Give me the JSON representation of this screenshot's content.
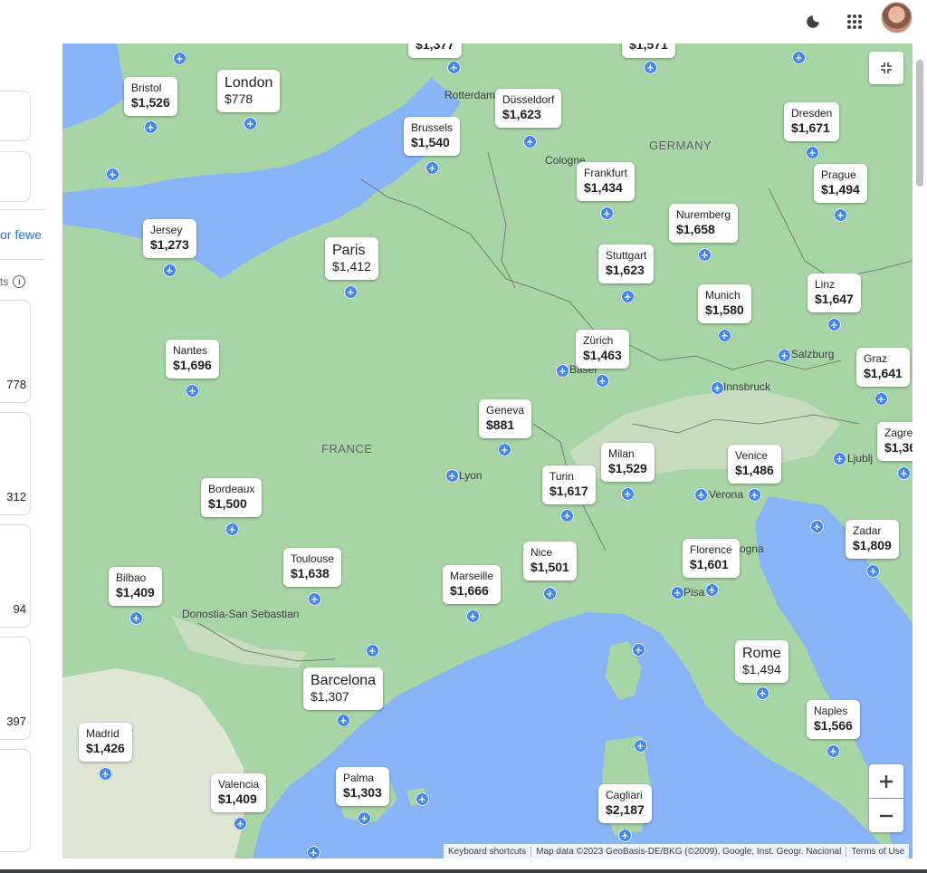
{
  "icons": {
    "theme": "moon-icon",
    "apps": "grid-icon",
    "airport": "plane-icon"
  },
  "left_panel": {
    "fewer_text": "or fewe",
    "pts_text": "ts",
    "card_prices": [
      "778",
      "312",
      "94",
      "397"
    ]
  },
  "map_labels": [
    {
      "name": "rotterdam",
      "text": "Rotterdam"
    },
    {
      "name": "cologne",
      "text": "Cologne"
    },
    {
      "name": "germany",
      "text": "GERMANY"
    },
    {
      "name": "france",
      "text": "FRANCE"
    },
    {
      "name": "basel",
      "text": "Basel"
    },
    {
      "name": "lyon",
      "text": "Lyon"
    },
    {
      "name": "salzburg",
      "text": "Salzburg"
    },
    {
      "name": "innsbruck",
      "text": "Innsbruck"
    },
    {
      "name": "verona",
      "text": "Verona"
    },
    {
      "name": "ljubljana",
      "text": "Ljublj"
    },
    {
      "name": "bologna",
      "text": "ogna"
    },
    {
      "name": "pisa",
      "text": "Pisa"
    },
    {
      "name": "donostia",
      "text": "Donostia-San Sebastian"
    }
  ],
  "destinations": [
    {
      "city": "",
      "price": "$1,377"
    },
    {
      "city": "",
      "price": "$1,571"
    },
    {
      "city": "Bristol",
      "price": "$1,526"
    },
    {
      "city": "London",
      "price": "$778"
    },
    {
      "city": "Düsseldorf",
      "price": "$1,623"
    },
    {
      "city": "Brussels",
      "price": "$1,540"
    },
    {
      "city": "Dresden",
      "price": "$1,671"
    },
    {
      "city": "Frankfurt",
      "price": "$1,434"
    },
    {
      "city": "Prague",
      "price": "$1,494"
    },
    {
      "city": "Jersey",
      "price": "$1,273"
    },
    {
      "city": "Nuremberg",
      "price": "$1,658"
    },
    {
      "city": "Paris",
      "price": "$1,412"
    },
    {
      "city": "Stuttgart",
      "price": "$1,623"
    },
    {
      "city": "Linz",
      "price": "$1,647"
    },
    {
      "city": "Munich",
      "price": "$1,580"
    },
    {
      "city": "Nantes",
      "price": "$1,696"
    },
    {
      "city": "Zürich",
      "price": "$1,463"
    },
    {
      "city": "Graz",
      "price": "$1,641"
    },
    {
      "city": "Geneva",
      "price": "$881"
    },
    {
      "city": "Zagre",
      "price": "$1,36"
    },
    {
      "city": "Milan",
      "price": "$1,529"
    },
    {
      "city": "Venice",
      "price": "$1,486"
    },
    {
      "city": "Turin",
      "price": "$1,617"
    },
    {
      "city": "Bordeaux",
      "price": "$1,500"
    },
    {
      "city": "Zadar",
      "price": "$1,809"
    },
    {
      "city": "Toulouse",
      "price": "$1,638"
    },
    {
      "city": "Nice",
      "price": "$1,501"
    },
    {
      "city": "Florence",
      "price": "$1,601"
    },
    {
      "city": "Bilbao",
      "price": "$1,409"
    },
    {
      "city": "Marseille",
      "price": "$1,666"
    },
    {
      "city": "Rome",
      "price": "$1,494"
    },
    {
      "city": "Barcelona",
      "price": "$1,307"
    },
    {
      "city": "Naples",
      "price": "$1,566"
    },
    {
      "city": "Madrid",
      "price": "$1,426"
    },
    {
      "city": "Palma",
      "price": "$1,303"
    },
    {
      "city": "Valencia",
      "price": "$1,409"
    },
    {
      "city": "Cagliari",
      "price": "$2,187"
    }
  ],
  "footer": {
    "shortcuts": "Keyboard shortcuts",
    "attribution": "Map data ©2023 GeoBasis-DE/BKG (©2009), Google, Inst. Geogr. Nacional",
    "terms": "Terms of Use"
  }
}
